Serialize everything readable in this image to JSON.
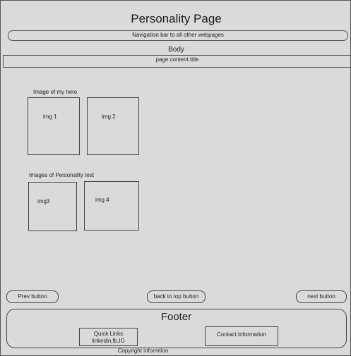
{
  "page": {
    "title": "Personality Page",
    "nav_text": "Navigation bar to all other webpages",
    "body_label": "Body",
    "content_title": "page content title"
  },
  "sections": {
    "hero_label": "Image of my hero",
    "test_label": "Images of Personality test"
  },
  "images": {
    "img1": "img 1",
    "img2": "img 2",
    "img3": "img3",
    "img4": "img 4"
  },
  "buttons": {
    "prev": "Prev button",
    "top": "back to top button",
    "next": "next button"
  },
  "footer": {
    "title": "Footer",
    "quick_links_line1": "Quick Links",
    "quick_links_line2": "linkedin,fb,IG",
    "contact": "Contact Information",
    "copyright": "Copyright informtion"
  }
}
